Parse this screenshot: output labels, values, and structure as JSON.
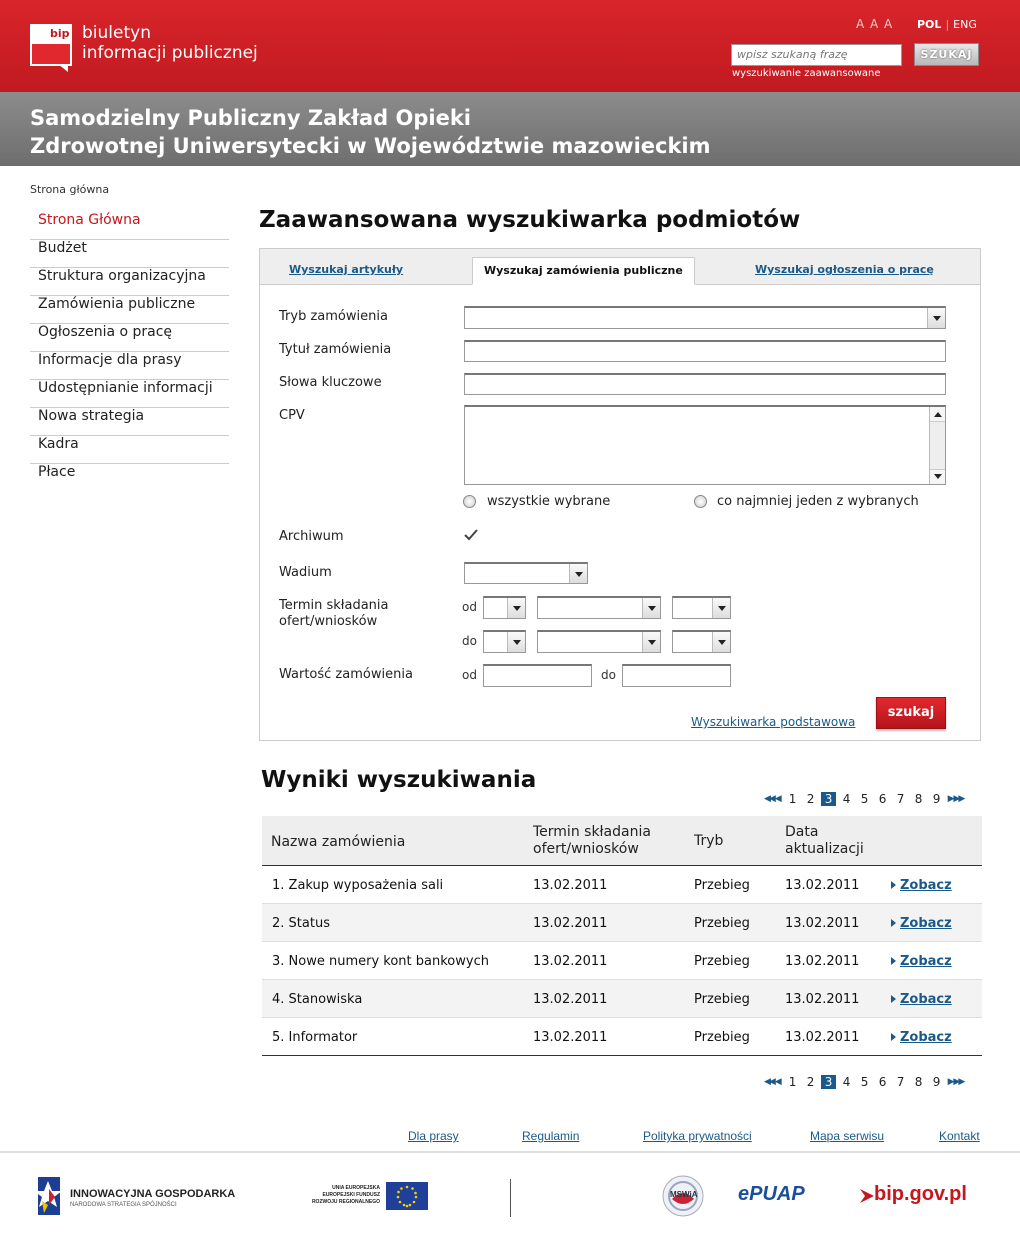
{
  "header": {
    "logo_bip": "bip",
    "logo_line1": "biuletyn",
    "logo_line2": "informacji publicznej",
    "font_size_controls": "A A A",
    "lang_pol": "POL",
    "lang_sep": "|",
    "lang_eng": "ENG",
    "search_placeholder": "wpisz szukaną frazę",
    "search_button": "SZUKAJ",
    "advanced_search_link": "wyszukiwanie zaawansowane"
  },
  "institution": {
    "line1": "Samodzielny Publiczny Zakład Opieki",
    "line2": "Zdrowotnej Uniwersytecki w Województwie mazowieckim"
  },
  "breadcrumb": "Strona główna",
  "sidebar": {
    "items": [
      {
        "label": "Strona Główna"
      },
      {
        "label": "Budżet"
      },
      {
        "label": "Struktura organizacyjna"
      },
      {
        "label": "Zamówienia publiczne"
      },
      {
        "label": "Ogłoszenia o pracę"
      },
      {
        "label": "Informacje dla prasy"
      },
      {
        "label": "Udostępnianie informacji"
      },
      {
        "label": "Nowa strategia"
      },
      {
        "label": "Kadra"
      },
      {
        "label": "Płace"
      }
    ]
  },
  "main": {
    "title": "Zaawansowana wyszukiwarka podmiotów",
    "tabs": [
      {
        "label": "Wyszukaj artykuły"
      },
      {
        "label": "Wyszukaj zamówienia publiczne"
      },
      {
        "label": "Wyszukaj ogłoszenia o pracę"
      }
    ],
    "form": {
      "tryb_label": "Tryb zamówienia",
      "tytul_label": "Tytuł zamówienia",
      "slowa_label": "Słowa kluczowe",
      "cpv_label": "CPV",
      "radio_all": "wszystkie wybrane",
      "radio_any": "co najmniej jeden z wybranych",
      "archiwum_label": "Archiwum",
      "wadium_label": "Wadium",
      "termin_label_1": "Termin składania",
      "termin_label_2": "ofert/wniosków",
      "od": "od",
      "do": "do",
      "wartosc_label": "Wartość zamówienia",
      "basic_link": "Wyszukiwarka podstawowa",
      "submit": "szukaj"
    }
  },
  "results": {
    "title": "Wyniki wyszukiwania",
    "pager": {
      "prev": "◀◀ ◀",
      "next": "▶ ▶▶",
      "pages": [
        "1",
        "2",
        "3",
        "4",
        "5",
        "6",
        "7",
        "8",
        "9"
      ],
      "current": "3"
    },
    "columns": [
      "Nazwa zamówienia",
      "Termin składania",
      "ofert/wniosków",
      "Tryb",
      "Data",
      "aktualizacji"
    ],
    "rows": [
      {
        "name": "1. Zakup wyposażenia sali",
        "termin": "13.02.2011",
        "tryb": "Przebieg",
        "data": "13.02.2011",
        "link": "Zobacz"
      },
      {
        "name": "2. Status",
        "termin": "13.02.2011",
        "tryb": "Przebieg",
        "data": "13.02.2011",
        "link": "Zobacz"
      },
      {
        "name": "3. Nowe numery kont bankowych",
        "termin": "13.02.2011",
        "tryb": "Przebieg",
        "data": "13.02.2011",
        "link": "Zobacz"
      },
      {
        "name": "4. Stanowiska",
        "termin": "13.02.2011",
        "tryb": "Przebieg",
        "data": "13.02.2011",
        "link": "Zobacz"
      },
      {
        "name": "5. Informator",
        "termin": "13.02.2011",
        "tryb": "Przebieg",
        "data": "13.02.2011",
        "link": "Zobacz"
      }
    ]
  },
  "footer": {
    "links": [
      "Dla prasy",
      "Regulamin",
      "Polityka prywatności",
      "Mapa serwisu",
      "Kontakt"
    ],
    "logo_ig_1": "INNOWACYJNA GOSPODARKA",
    "logo_ig_2": "NARODOWA STRATEGIA SPÓJNOŚCI",
    "logo_ue_1": "UNIA EUROPEJSKA",
    "logo_ue_2": "EUROPEJSKI FUNDUSZ",
    "logo_ue_3": "ROZWOJU REGIONALNEGO",
    "logo_mswia": "MSWiA",
    "logo_epuap": "ePUAP",
    "logo_bipgov": "bip.gov.pl"
  },
  "colors": {
    "brand_red": "#c8161d",
    "link_blue": "#1a5a8a",
    "title_gray": "#7a7a7a"
  }
}
